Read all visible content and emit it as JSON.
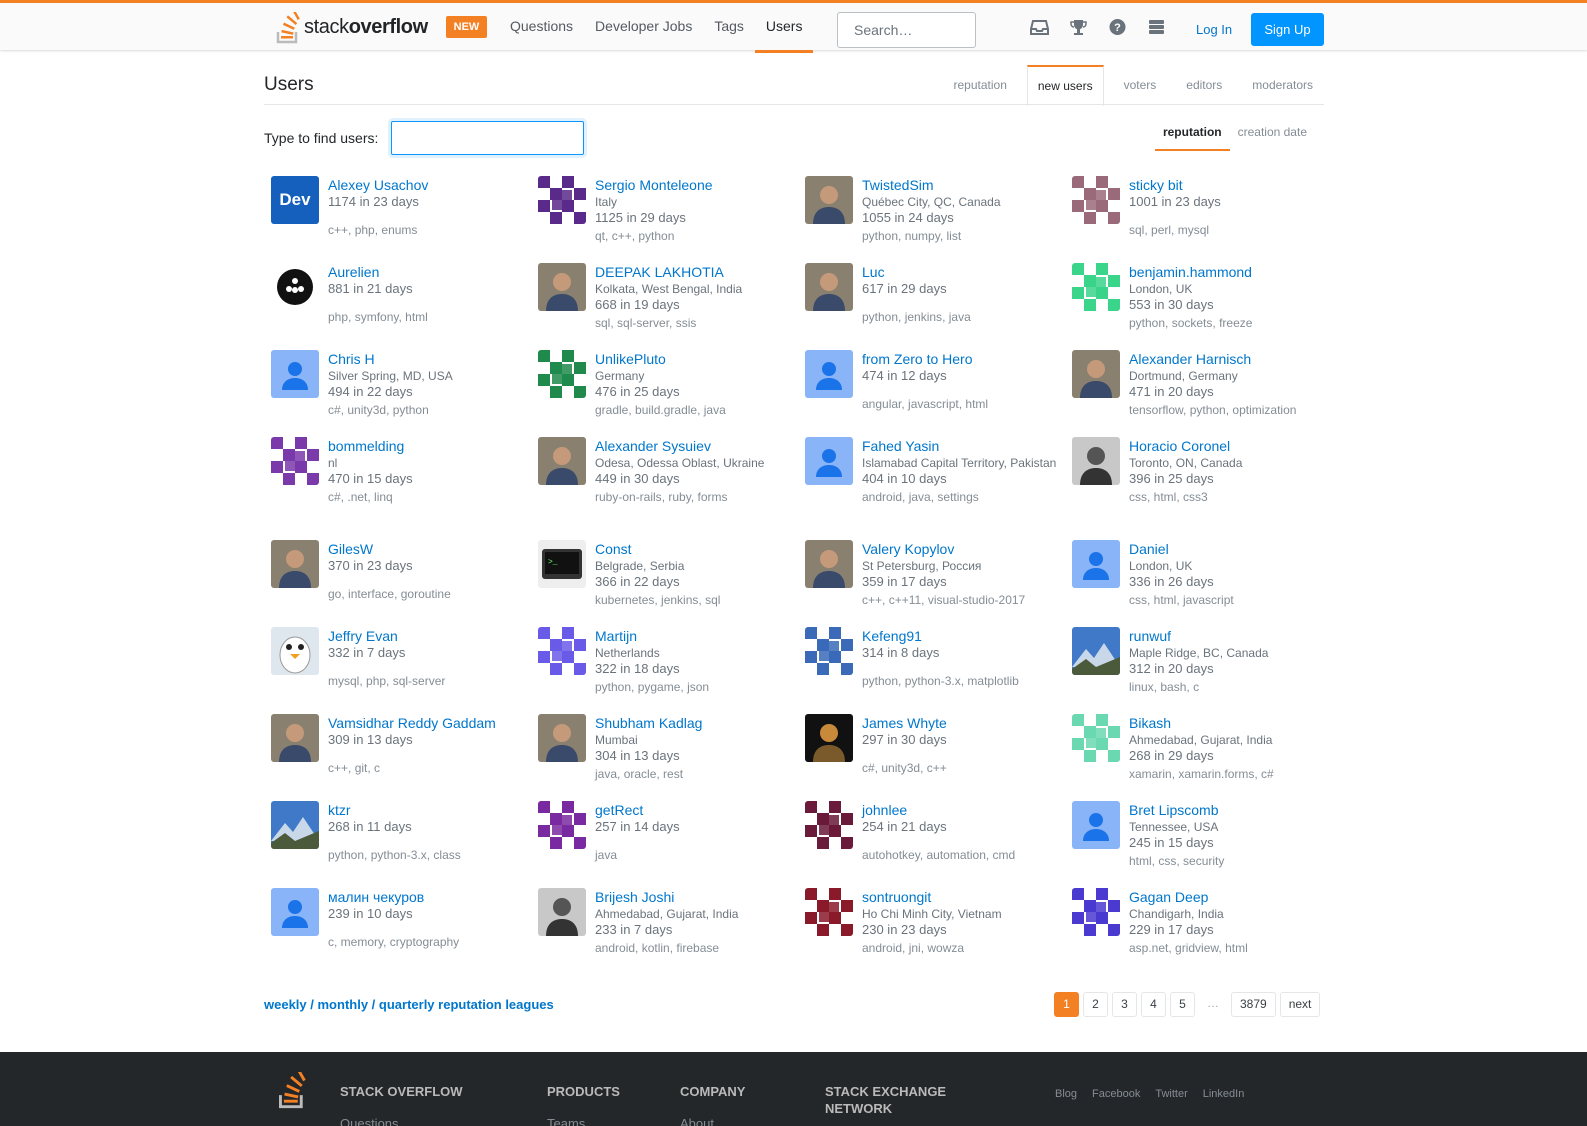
{
  "topbar": {
    "logo_a": "stack",
    "logo_b": "overflow",
    "new_badge": "NEW",
    "nav": [
      "Questions",
      "Developer Jobs",
      "Tags",
      "Users"
    ],
    "search_placeholder": "Search…",
    "login": "Log In",
    "signup": "Sign Up",
    "icons": [
      "inbox-icon",
      "achievements-icon",
      "help-icon",
      "review-icon"
    ],
    "accent": "#f48024",
    "link_color": "#0077cc"
  },
  "header": {
    "title": "Users",
    "tabs": [
      "reputation",
      "new users",
      "voters",
      "editors",
      "moderators"
    ],
    "find_label": "Type to find users:",
    "find_value": "",
    "sort": [
      "reputation",
      "creation date"
    ]
  },
  "users": [
    {
      "name": "Alexey Usachov",
      "location": "",
      "rep": "1174 in 23 days",
      "tags": [
        "c++",
        "php",
        "enums"
      ],
      "avatar": "dev"
    },
    {
      "name": "Sergio Monteleone",
      "location": "Italy",
      "rep": "1125 in 29 days",
      "tags": [
        "qt",
        "c++",
        "python"
      ],
      "avatar": "identicon-purple"
    },
    {
      "name": "TwistedSim",
      "location": "Québec City, QC, Canada",
      "rep": "1055 in 24 days",
      "tags": [
        "python",
        "numpy",
        "list"
      ],
      "avatar": "photo"
    },
    {
      "name": "sticky bit",
      "location": "",
      "rep": "1001 in 23 days",
      "tags": [
        "sql",
        "perl",
        "mysql"
      ],
      "avatar": "identicon-mauve"
    },
    {
      "name": "Aurelien",
      "location": "",
      "rep": "881 in 21 days",
      "tags": [
        "php",
        "symfony",
        "html"
      ],
      "avatar": "dots"
    },
    {
      "name": "DEEPAK LAKHOTIA",
      "location": "Kolkata, West Bengal, India",
      "rep": "668 in 19 days",
      "tags": [
        "sql",
        "sql-server",
        "ssis"
      ],
      "avatar": "photo"
    },
    {
      "name": "Luc",
      "location": "",
      "rep": "617 in 29 days",
      "tags": [
        "python",
        "jenkins",
        "java"
      ],
      "avatar": "photo"
    },
    {
      "name": "benjamin.hammond",
      "location": "London, UK",
      "rep": "553 in 30 days",
      "tags": [
        "python",
        "sockets",
        "freeze"
      ],
      "avatar": "identicon-green"
    },
    {
      "name": "Chris H",
      "location": "Silver Spring, MD, USA",
      "rep": "494 in 22 days",
      "tags": [
        "c#",
        "unity3d",
        "python"
      ],
      "avatar": "default"
    },
    {
      "name": "UnlikePluto",
      "location": "Germany",
      "rep": "476 in 25 days",
      "tags": [
        "gradle",
        "build.gradle",
        "java"
      ],
      "avatar": "identicon-darkgreen"
    },
    {
      "name": "from Zero to Hero",
      "location": "",
      "rep": "474 in 12 days",
      "tags": [
        "angular",
        "javascript",
        "html"
      ],
      "avatar": "default"
    },
    {
      "name": "Alexander Harnisch",
      "location": "Dortmund, Germany",
      "rep": "471 in 20 days",
      "tags": [
        "tensorflow",
        "python",
        "optimization"
      ],
      "avatar": "photo"
    },
    {
      "name": "bommelding",
      "location": "nl",
      "rep": "470 in 15 days",
      "tags": [
        "c#",
        ".net",
        "linq"
      ],
      "avatar": "identicon-violet"
    },
    {
      "name": "Alexander Sysuiev",
      "location": "Odesa, Odessa Oblast, Ukraine",
      "rep": "449 in 30 days",
      "tags": [
        "ruby-on-rails",
        "ruby",
        "forms"
      ],
      "avatar": "photo"
    },
    {
      "name": "Fahed Yasin",
      "location": "Islamabad Capital Territory, Pakistan",
      "rep": "404 in 10 days",
      "tags": [
        "android",
        "java",
        "settings"
      ],
      "avatar": "default"
    },
    {
      "name": "Horacio Coronel",
      "location": "Toronto, ON, Canada",
      "rep": "396 in 25 days",
      "tags": [
        "css",
        "html",
        "css3"
      ],
      "avatar": "photo-bw"
    },
    {
      "name": "GilesW",
      "location": "",
      "rep": "370 in 23 days",
      "tags": [
        "go",
        "interface",
        "goroutine"
      ],
      "avatar": "photo"
    },
    {
      "name": "Const",
      "location": "Belgrade, Serbia",
      "rep": "366 in 22 days",
      "tags": [
        "kubernetes",
        "jenkins",
        "sql"
      ],
      "avatar": "terminal"
    },
    {
      "name": "Valery Kopylov",
      "location": "St Petersburg, Россия",
      "rep": "359 in 17 days",
      "tags": [
        "c++",
        "c++11",
        "visual-studio-2017"
      ],
      "avatar": "photo"
    },
    {
      "name": "Daniel",
      "location": "London, UK",
      "rep": "336 in 26 days",
      "tags": [
        "css",
        "html",
        "javascript"
      ],
      "avatar": "default"
    },
    {
      "name": "Jeffry Evan",
      "location": "",
      "rep": "332 in 7 days",
      "tags": [
        "mysql",
        "php",
        "sql-server"
      ],
      "avatar": "penguin"
    },
    {
      "name": "Martijn",
      "location": "Netherlands",
      "rep": "322 in 18 days",
      "tags": [
        "python",
        "pygame",
        "json"
      ],
      "avatar": "identicon-blueviolet"
    },
    {
      "name": "Kefeng91",
      "location": "",
      "rep": "314 in 8 days",
      "tags": [
        "python",
        "python-3.x",
        "matplotlib"
      ],
      "avatar": "identicon-blue"
    },
    {
      "name": "runwuf",
      "location": "Maple Ridge, BC, Canada",
      "rep": "312 in 20 days",
      "tags": [
        "linux",
        "bash",
        "c"
      ],
      "avatar": "mountain"
    },
    {
      "name": "Vamsidhar Reddy Gaddam",
      "location": "",
      "rep": "309 in 13 days",
      "tags": [
        "c++",
        "git",
        "c"
      ],
      "avatar": "photo"
    },
    {
      "name": "Shubham Kadlag",
      "location": "Mumbai",
      "rep": "304 in 13 days",
      "tags": [
        "java",
        "oracle",
        "rest"
      ],
      "avatar": "photo"
    },
    {
      "name": "James Whyte",
      "location": "",
      "rep": "297 in 30 days",
      "tags": [
        "c#",
        "unity3d",
        "c++"
      ],
      "avatar": "photo-dark"
    },
    {
      "name": "Bikash",
      "location": "Ahmedabad, Gujarat, India",
      "rep": "268 in 29 days",
      "tags": [
        "xamarin",
        "xamarin.forms",
        "c#"
      ],
      "avatar": "identicon-mint"
    },
    {
      "name": "ktzr",
      "location": "",
      "rep": "268 in 11 days",
      "tags": [
        "python",
        "python-3.x",
        "class"
      ],
      "avatar": "mountain"
    },
    {
      "name": "getRect",
      "location": "",
      "rep": "257 in 14 days",
      "tags": [
        "java"
      ],
      "avatar": "identicon-purple2"
    },
    {
      "name": "johnlee",
      "location": "",
      "rep": "254 in 21 days",
      "tags": [
        "autohotkey",
        "automation",
        "cmd"
      ],
      "avatar": "identicon-maroon"
    },
    {
      "name": "Bret Lipscomb",
      "location": "Tennessee, USA",
      "rep": "245 in 15 days",
      "tags": [
        "html",
        "css",
        "security"
      ],
      "avatar": "default"
    },
    {
      "name": "малин чекуров",
      "location": "",
      "rep": "239 in 10 days",
      "tags": [
        "c",
        "memory",
        "cryptography"
      ],
      "avatar": "default"
    },
    {
      "name": "Brijesh Joshi",
      "location": "Ahmedabad, Gujarat, India",
      "rep": "233 in 7 days",
      "tags": [
        "android",
        "kotlin",
        "firebase"
      ],
      "avatar": "photo-bw"
    },
    {
      "name": "sontruongit",
      "location": "Ho Chi Minh City, Vietnam",
      "rep": "230 in 23 days",
      "tags": [
        "android",
        "jni",
        "wowza"
      ],
      "avatar": "identicon-red"
    },
    {
      "name": "Gagan Deep",
      "location": "Chandigarh, India",
      "rep": "229 in 17 days",
      "tags": [
        "asp.net",
        "gridview",
        "html"
      ],
      "avatar": "identicon-indigo"
    }
  ],
  "leagues": {
    "weekly": "weekly",
    "monthly": "monthly",
    "quarterly": "quarterly reputation leagues"
  },
  "pager": [
    "1",
    "2",
    "3",
    "4",
    "5",
    "…",
    "3879",
    "next"
  ],
  "footer": {
    "cols": [
      "STACK OVERFLOW",
      "PRODUCTS",
      "COMPANY",
      "STACK EXCHANGE NETWORK"
    ],
    "links": [
      "Questions",
      "Teams",
      "About"
    ],
    "social": [
      "Blog",
      "Facebook",
      "Twitter",
      "LinkedIn"
    ]
  }
}
